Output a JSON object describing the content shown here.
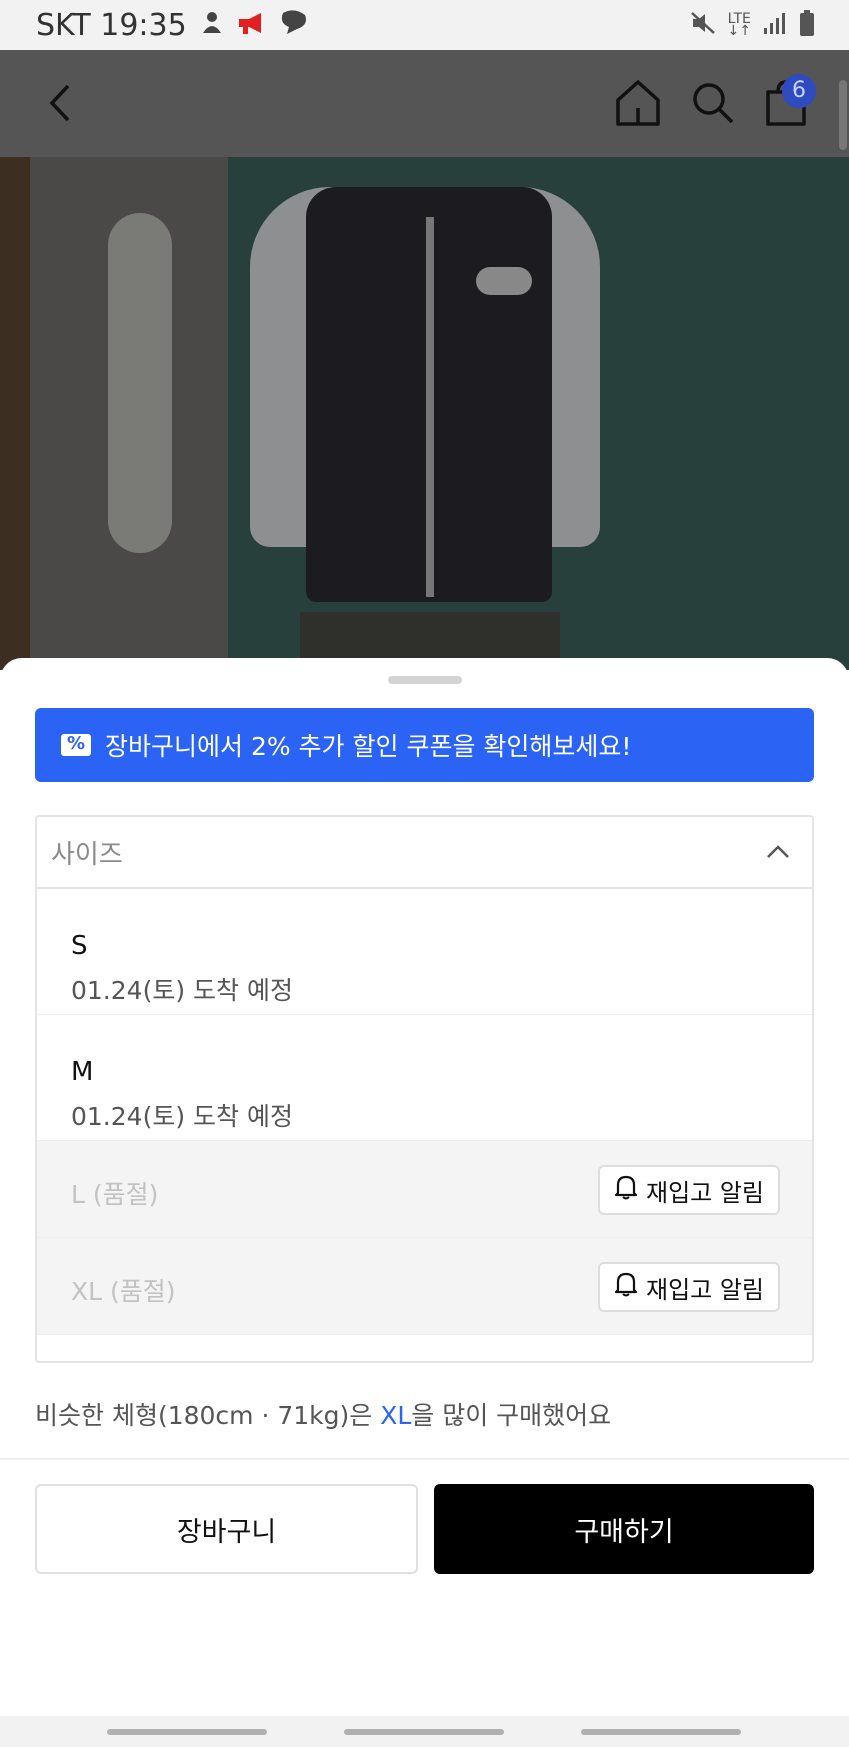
{
  "status_bar": {
    "carrier_time": "SKT 19:35",
    "network": "LTE"
  },
  "header": {
    "cart_count": "6"
  },
  "sheet": {
    "coupon_text": "장바구니에서 2% 추가 할인 쿠폰을 확인해보세요!",
    "size_select": {
      "label": "사이즈",
      "options": [
        {
          "size": "S",
          "eta": "01.24(토) 도착 예정"
        },
        {
          "size": "M",
          "eta": "01.24(토) 도착 예정"
        },
        {
          "size": "L (품절)",
          "restock_label": "재입고 알림"
        },
        {
          "size": "XL (품절)",
          "restock_label": "재입고 알림"
        }
      ]
    },
    "recommend": {
      "prefix": "비슷한 체형(180cm · 71kg)은 ",
      "highlight": "XL",
      "suffix": "을 많이 구매했어요"
    },
    "cart_button": "장바구니",
    "buy_button": "구매하기"
  },
  "colors": {
    "accent": "#2b63f5",
    "buy": "#000000"
  }
}
